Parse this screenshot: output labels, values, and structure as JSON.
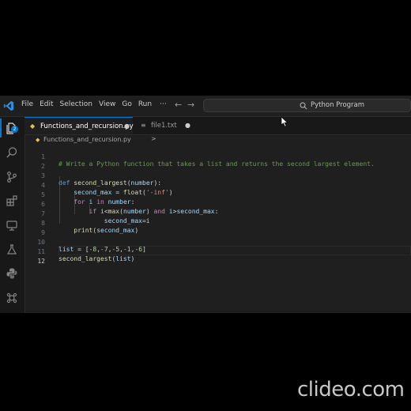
{
  "menu": [
    "File",
    "Edit",
    "Selection",
    "View",
    "Go",
    "Run",
    "···"
  ],
  "nav": {
    "back": "←",
    "forward": "→"
  },
  "search": {
    "text": "Python Program"
  },
  "activity": {
    "badge": "2"
  },
  "tabs": [
    {
      "label": "Functions_and_recursion.py",
      "modified_marker": "●"
    },
    {
      "label": "file1.txt",
      "modified_marker": "●"
    }
  ],
  "breadcrumb": {
    "file": "Functions_and_recursion.py",
    "sep": ">"
  },
  "editor": {
    "lines": [
      {
        "n": "1",
        "text": "# Write a Python function that takes a list and returns the second largest element."
      },
      {
        "n": "2",
        "text": ""
      },
      {
        "n": "3",
        "text": "def second_largest(number):"
      },
      {
        "n": "4",
        "text": "    second_max = float('-inf')"
      },
      {
        "n": "5",
        "text": "    for i in number:"
      },
      {
        "n": "6",
        "text": "        if i<max(number) and i>second_max:"
      },
      {
        "n": "7",
        "text": "            second_max=i"
      },
      {
        "n": "8",
        "text": "    print(second_max)"
      },
      {
        "n": "9",
        "text": ""
      },
      {
        "n": "10",
        "text": "list = [-8,-7,-5,-1,-6]"
      },
      {
        "n": "11",
        "text": "second_largest(list)"
      },
      {
        "n": "12",
        "text": ""
      }
    ]
  },
  "watermark": "clideo.com",
  "colors": {
    "accent": "#0078d4",
    "editor_bg": "#1f1f1f",
    "comment": "#6a9955",
    "keyword": "#569cd6"
  }
}
